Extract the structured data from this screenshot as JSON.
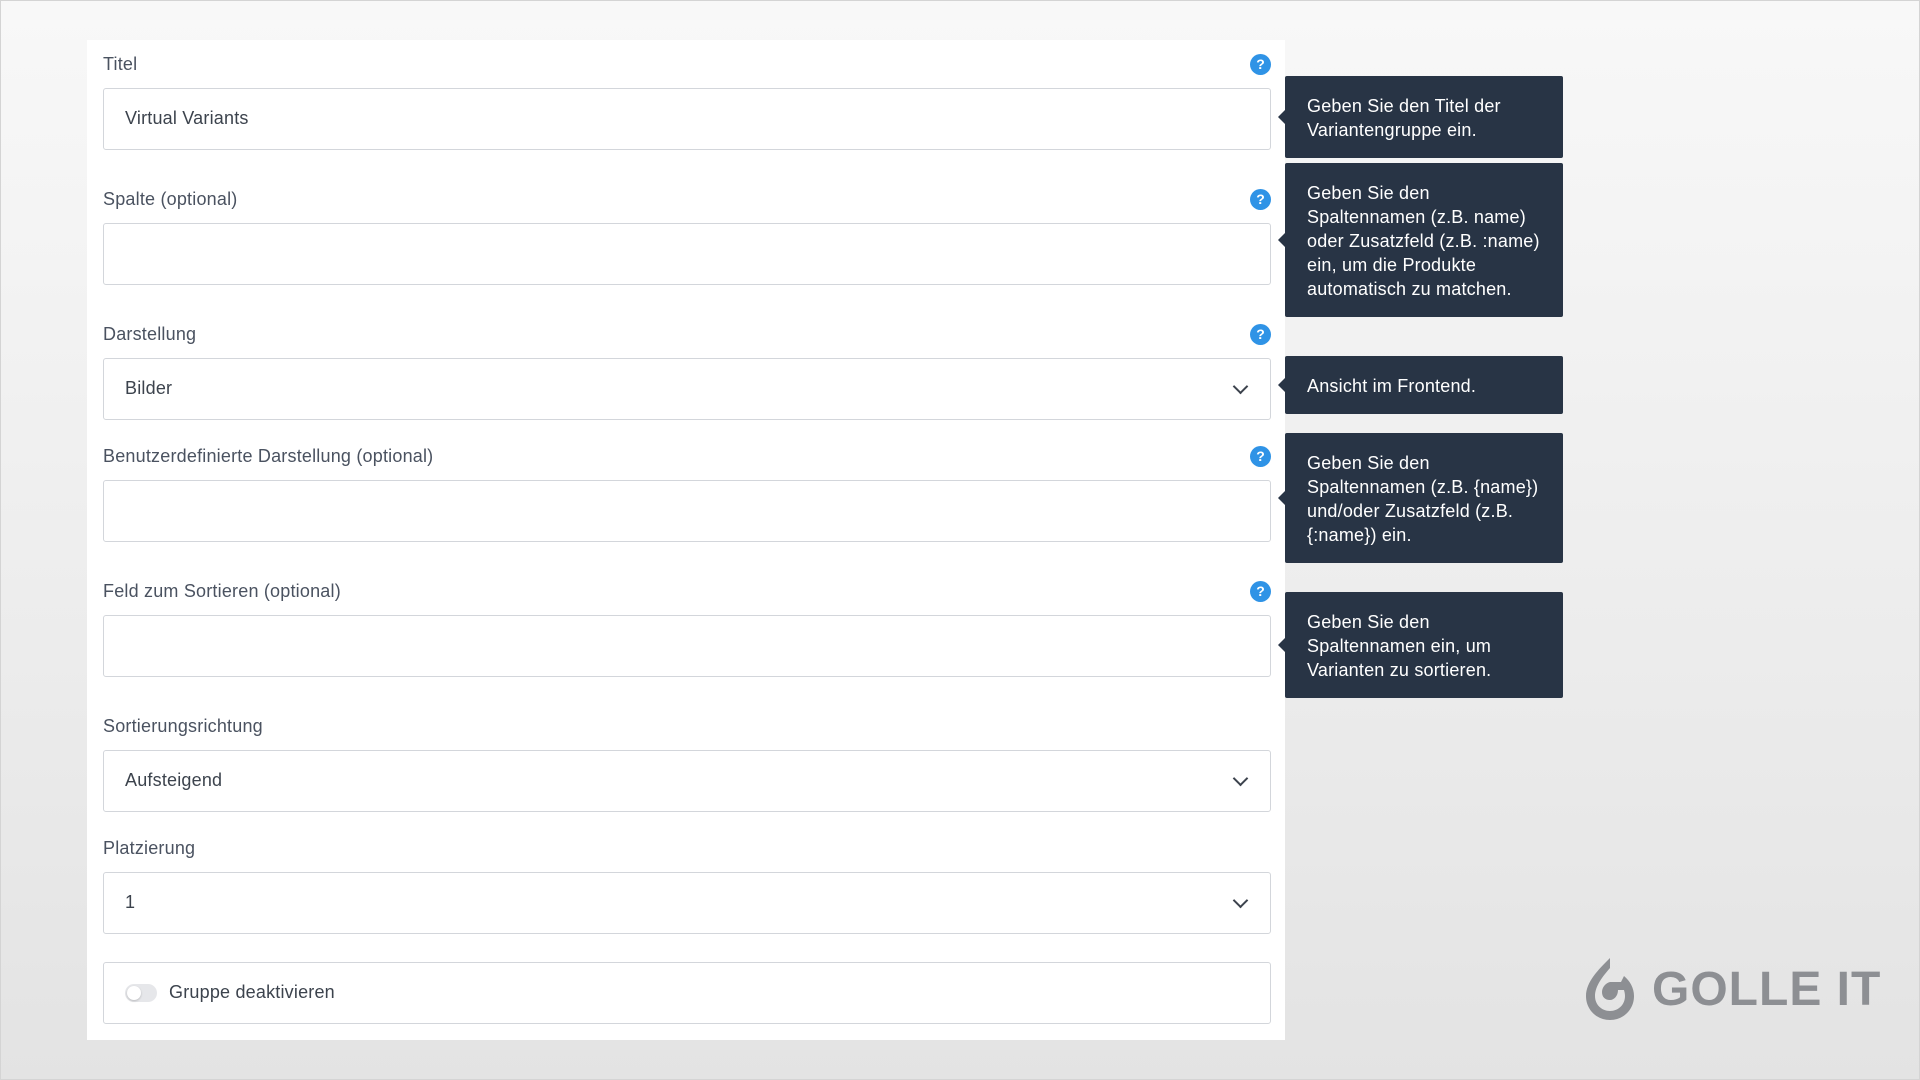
{
  "form": {
    "fields": [
      {
        "label": "Titel",
        "value": "Virtual Variants",
        "type": "text",
        "has_help": true
      },
      {
        "label": "Spalte (optional)",
        "value": "",
        "type": "text",
        "has_help": true
      },
      {
        "label": "Darstellung",
        "value": "Bilder",
        "type": "select",
        "has_help": true
      },
      {
        "label": "Benutzerdefinierte Darstellung (optional)",
        "value": "",
        "type": "text",
        "has_help": true
      },
      {
        "label": "Feld zum Sortieren (optional)",
        "value": "",
        "type": "text",
        "has_help": true
      },
      {
        "label": "Sortierungsrichtung",
        "value": "Aufsteigend",
        "type": "select",
        "has_help": false
      },
      {
        "label": "Platzierung",
        "value": "1",
        "type": "select",
        "has_help": false
      }
    ],
    "toggle": {
      "label": "Gruppe deaktivieren",
      "checked": false
    },
    "help_glyph": "?"
  },
  "tooltips": [
    {
      "text": "Geben Sie den Titel der Variantengruppe ein."
    },
    {
      "text": "Geben Sie den Spaltennamen (z.B. name) oder Zusatzfeld (z.B. :name) ein, um die Produkte automatisch zu matchen."
    },
    {
      "text": "Ansicht im Frontend."
    },
    {
      "text": "Geben Sie den Spaltennamen (z.B. {name}) und/oder Zusatzfeld (z.B. {:name}) ein."
    },
    {
      "text": "Geben Sie den Spaltennamen ein, um Varianten zu sortieren."
    }
  ],
  "logo": {
    "text": "GOLLE IT",
    "icon": "golle-it-logo-icon"
  },
  "colors": {
    "help_icon": "#2f93e6",
    "tooltip_bg": "#283445",
    "border": "#d3d6db",
    "label": "#4a5260",
    "logo": "#8d8f93"
  }
}
